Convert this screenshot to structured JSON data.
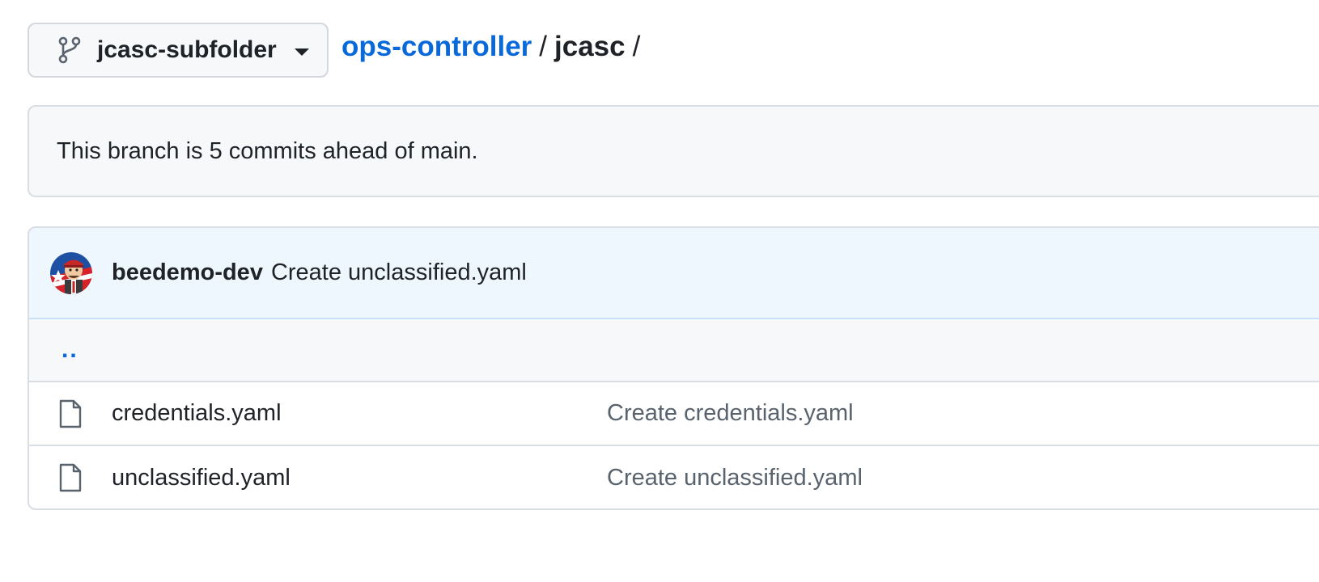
{
  "branch_selector": {
    "name": "jcasc-subfolder",
    "icon": "git-branch-icon"
  },
  "breadcrumb": {
    "repo": "ops-controller",
    "separator": "/",
    "folder": "jcasc",
    "trailing_separator": "/"
  },
  "ahead_notice": {
    "text": "This branch is 5 commits ahead of main."
  },
  "latest_commit": {
    "author": "beedemo-dev",
    "message": "Create unclassified.yaml"
  },
  "file_list": {
    "parent_link": "..",
    "files": [
      {
        "name": "credentials.yaml",
        "commit_message": "Create credentials.yaml",
        "icon": "file-icon"
      },
      {
        "name": "unclassified.yaml",
        "commit_message": "Create unclassified.yaml",
        "icon": "file-icon"
      }
    ]
  },
  "colors": {
    "link": "#0969da",
    "text": "#1f2328",
    "muted": "#59636e",
    "border": "#d8dee4",
    "header_bg": "#eef6fe",
    "box_bg": "#f6f8fa"
  }
}
